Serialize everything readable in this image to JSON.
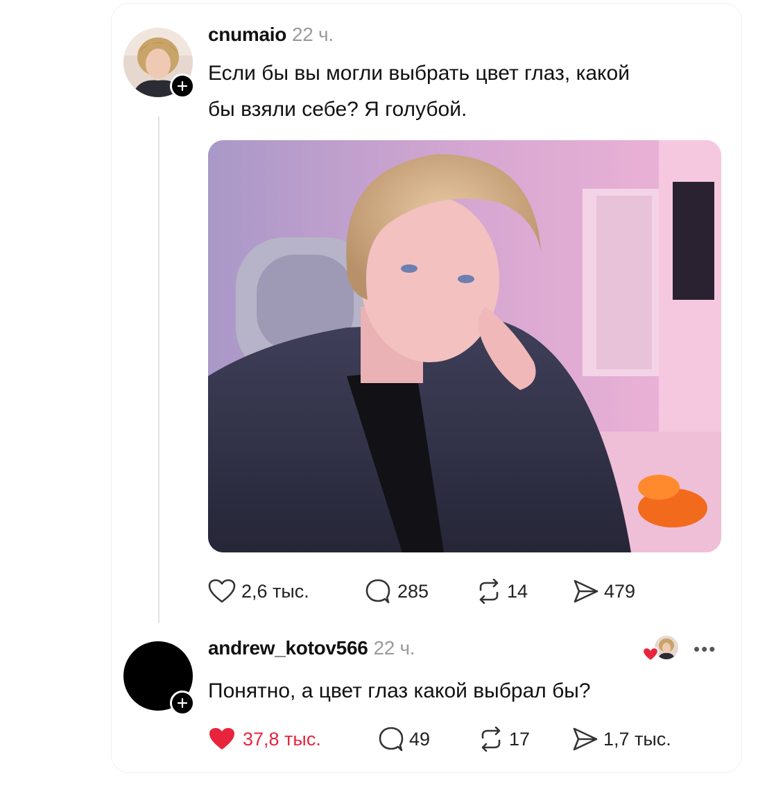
{
  "post": {
    "username": "cnumaio",
    "time": "22 ч.",
    "text_line1": "Если бы вы могли выбрать цвет глаз, какой",
    "text_line2": "бы взяли себе? Я голубой.",
    "image_description": "selfie photo in pink-lit room",
    "stats": {
      "likes": "2,6 тыс.",
      "comments": "285",
      "reposts": "14",
      "shares": "479"
    }
  },
  "reply": {
    "username": "andrew_kotov566",
    "time": "22 ч.",
    "text": "Понятно, а цвет глаз какой выбрал бы?",
    "liked_by_author": true,
    "stats": {
      "likes": "37,8 тыс.",
      "comments": "49",
      "reposts": "17",
      "shares": "1,7 тыс."
    }
  },
  "icons": {
    "like": "heart-icon",
    "comment": "speech-bubble-icon",
    "repost": "repost-icon",
    "share": "send-icon",
    "follow": "plus-icon",
    "more": "more-icon"
  },
  "colors": {
    "liked": "#e8243c",
    "text": "#111111",
    "muted": "#9a9a9a",
    "thread_line": "#e2e2e2"
  }
}
